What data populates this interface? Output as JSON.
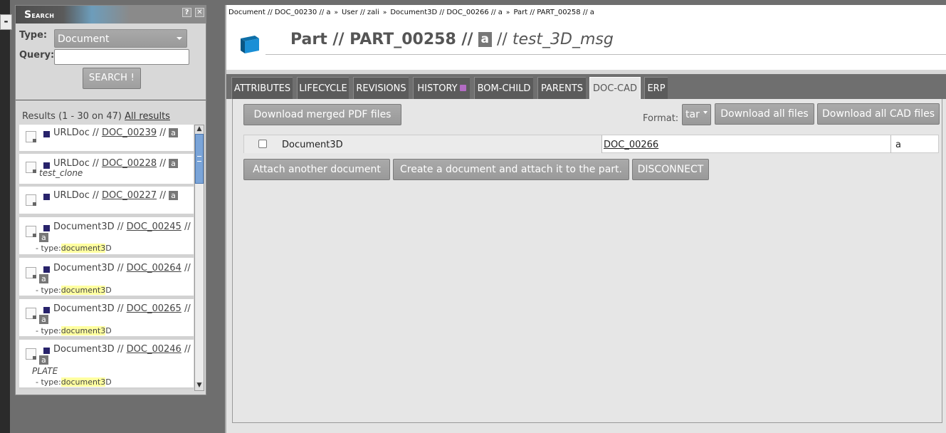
{
  "search_panel": {
    "title_first": "S",
    "title_rest": "earch",
    "help_icon": "?",
    "close_icon": "✕",
    "type_label": "Type:",
    "type_value": "Document",
    "query_label": "Query:",
    "query_value": "",
    "search_button": "SEARCH !",
    "results_text": "Results (1 - 30 on 47)",
    "all_results_link": "All results",
    "results": [
      {
        "prefix": "URLDoc // ",
        "ref": "DOC_00239",
        "suffix": " // ",
        "rev": "a"
      },
      {
        "prefix": "URLDoc // ",
        "ref": "DOC_00228",
        "suffix": " // ",
        "rev": "a",
        "subtitle": "test_clone"
      },
      {
        "prefix": "URLDoc // ",
        "ref": "DOC_00227",
        "suffix": " // ",
        "rev": "a"
      },
      {
        "prefix": "Document3D // ",
        "ref": "DOC_00245",
        "suffix": " //",
        "rev": "a",
        "meta_prefix": "- type:",
        "meta_hl": "document3",
        "meta_rest": "D"
      },
      {
        "prefix": "Document3D // ",
        "ref": "DOC_00264",
        "suffix": " //",
        "rev": "a",
        "meta_prefix": "- type:",
        "meta_hl": "document3",
        "meta_rest": "D"
      },
      {
        "prefix": "Document3D // ",
        "ref": "DOC_00265",
        "suffix": " //",
        "rev": "a",
        "meta_prefix": "- type:",
        "meta_hl": "document3",
        "meta_rest": "D"
      },
      {
        "prefix": "Document3D // ",
        "ref": "DOC_00246",
        "suffix": " //",
        "rev": "a",
        "subtitle": "PLATE",
        "meta_prefix": "- type:",
        "meta_hl": "document3",
        "meta_rest": "D"
      }
    ]
  },
  "collapse_button": "-",
  "breadcrumb": [
    "Document // DOC_00230 // a",
    "User // zali",
    "Document3D // DOC_00266 // a",
    "Part // PART_00258 // a"
  ],
  "breadcrumb_sep": "»",
  "page_title": {
    "type_ref": "Part // PART_00258 //",
    "rev": "a",
    "sep": "//",
    "name": "test_3D_msg"
  },
  "tabs": [
    "ATTRIBUTES",
    "LIFECYCLE",
    "REVISIONS",
    "HISTORY",
    "BOM-CHILD",
    "PARENTS",
    "DOC-CAD",
    "ERP"
  ],
  "active_tab": "DOC-CAD",
  "actions": {
    "merged_pdf": "Download merged PDF files",
    "format_label": "Format:",
    "format_value": "tar",
    "download_all": "Download all files",
    "download_cad": "Download all CAD files",
    "attach": "Attach another document",
    "create_attach": "Create a document and attach it to the part.",
    "disconnect": "DISCONNECT"
  },
  "attached_documents": [
    {
      "type": "Document3D",
      "reference": "DOC_00266",
      "revision": "a"
    }
  ],
  "colors": {
    "accent_blue": "#1a8fd6",
    "result_square": "#28236b",
    "highlight": "#ffffa0"
  }
}
